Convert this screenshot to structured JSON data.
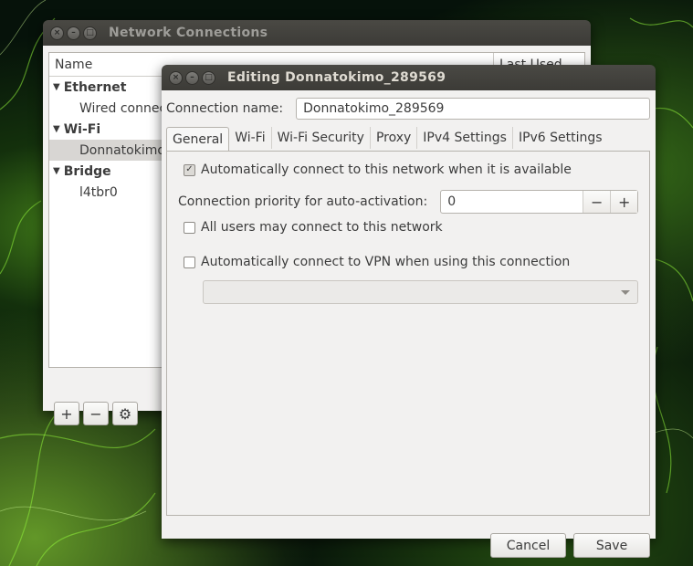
{
  "network_window": {
    "title": "Network Connections",
    "columns": {
      "name": "Name",
      "last_used": "Last Used"
    },
    "groups": [
      {
        "label": "Ethernet",
        "items": [
          "Wired connec"
        ]
      },
      {
        "label": "Wi-Fi",
        "items": [
          "Donnatokimo"
        ]
      },
      {
        "label": "Bridge",
        "items": [
          "l4tbr0"
        ]
      }
    ],
    "tools": {
      "add": "+",
      "remove": "−",
      "settings": "⚙"
    }
  },
  "editor": {
    "title": "Editing Donnatokimo_289569",
    "connection_name_label": "Connection name:",
    "connection_name_value": "Donnatokimo_289569",
    "tabs": [
      "General",
      "Wi-Fi",
      "Wi-Fi Security",
      "Proxy",
      "IPv4 Settings",
      "IPv6 Settings"
    ],
    "active_tab": "General",
    "general": {
      "auto_connect_label": "Automatically connect to this network when it is available",
      "auto_connect_checked": true,
      "priority_label": "Connection priority for auto-activation:",
      "priority_value": "0",
      "all_users_label": "All users may connect to this network",
      "all_users_checked": false,
      "vpn_label": "Automatically connect to VPN when using this connection",
      "vpn_checked": false,
      "vpn_selected": ""
    },
    "buttons": {
      "cancel": "Cancel",
      "save": "Save"
    }
  },
  "colors": {
    "titlebar": "#3c3b37",
    "window_bg": "#f2f1f0",
    "selection": "#d8d6d3",
    "wallpaper_glow": "#7ddc28"
  }
}
